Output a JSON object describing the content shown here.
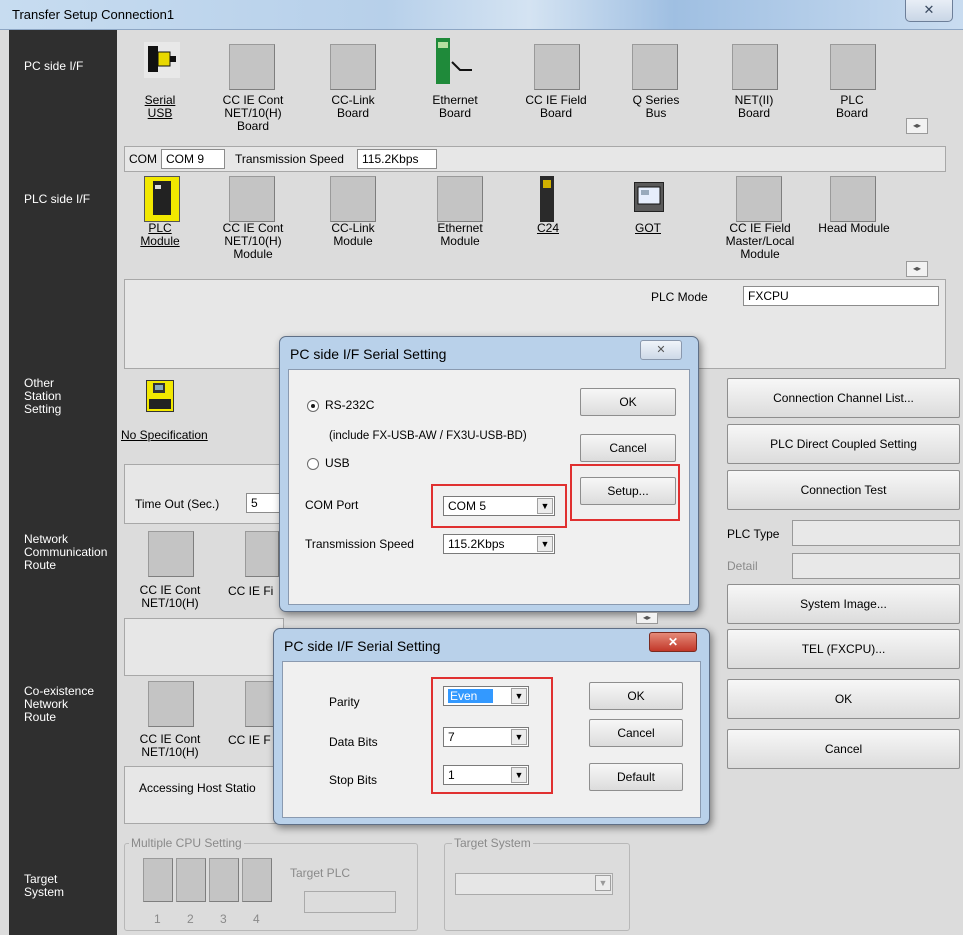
{
  "window": {
    "title": "Transfer Setup Connection1",
    "close_icon": "close-icon"
  },
  "side_labels": {
    "pc_side": "PC side I/F",
    "plc_side": "PLC side I/F",
    "other_station": [
      "Other",
      "Station",
      "Setting"
    ],
    "network_route": [
      "Network",
      "Communication",
      "Route"
    ],
    "coexistence": [
      "Co-existence",
      "Network",
      "Route"
    ],
    "target_system": [
      "Target",
      "System"
    ]
  },
  "pc_side_items": [
    {
      "lines": [
        "Serial",
        "USB"
      ],
      "underline": true
    },
    {
      "lines": [
        "CC IE Cont",
        "NET/10(H)",
        "Board"
      ]
    },
    {
      "lines": [
        "CC-Link",
        "Board"
      ]
    },
    {
      "lines": [
        "Ethernet",
        "Board"
      ]
    },
    {
      "lines": [
        "CC IE Field",
        "Board"
      ]
    },
    {
      "lines": [
        "Q Series",
        "Bus"
      ]
    },
    {
      "lines": [
        "NET(II)",
        "Board"
      ]
    },
    {
      "lines": [
        "PLC",
        "Board"
      ]
    }
  ],
  "pc_info": {
    "com_label": "COM",
    "com_value": "COM 9",
    "speed_label": "Transmission Speed",
    "speed_value": "115.2Kbps"
  },
  "plc_side_items": [
    {
      "lines": [
        "PLC",
        "Module"
      ],
      "underline": true
    },
    {
      "lines": [
        "CC IE Cont",
        "NET/10(H)",
        "Module"
      ]
    },
    {
      "lines": [
        "CC-Link",
        "Module"
      ]
    },
    {
      "lines": [
        "Ethernet",
        "Module"
      ]
    },
    {
      "lines": [
        "C24"
      ],
      "underline": true
    },
    {
      "lines": [
        "GOT"
      ],
      "underline": true
    },
    {
      "lines": [
        "CC IE Field",
        "Master/Local",
        "Module"
      ]
    },
    {
      "lines": [
        "Head Module"
      ]
    }
  ],
  "plc_mode": {
    "label": "PLC Mode",
    "value": "FXCPU"
  },
  "other_station": {
    "label": "No Specification",
    "timeout_label": "Time Out (Sec.)",
    "timeout_value": "5"
  },
  "network_items": [
    "CC IE Cont",
    "NET/10(H)",
    "CC IE Fi"
  ],
  "coexist_items": [
    "CC IE Cont",
    "NET/10(H)",
    "CC IE F"
  ],
  "accessing_host": "Accessing Host Statio",
  "right_buttons": {
    "channel_list": "Connection Channel List...",
    "direct_coupled": "PLC Direct Coupled Setting",
    "connection_test": "Connection Test",
    "plc_type_label": "PLC Type",
    "detail_label": "Detail",
    "system_image": "System Image...",
    "tel": "TEL (FXCPU)...",
    "ok": "OK",
    "cancel": "Cancel"
  },
  "target": {
    "multi_cpu_label": "Multiple CPU Setting",
    "target_plc_label": "Target PLC",
    "cpu_numbers": [
      "1",
      "2",
      "3",
      "4"
    ],
    "target_system_label": "Target System"
  },
  "dialog1": {
    "title": "PC side I/F Serial Setting",
    "rs232c": "RS-232C",
    "include_note": "(include FX-USB-AW / FX3U-USB-BD)",
    "usb": "USB",
    "com_port_label": "COM Port",
    "com_port_value": "COM 5",
    "speed_label": "Transmission Speed",
    "speed_value": "115.2Kbps",
    "ok": "OK",
    "cancel": "Cancel",
    "setup": "Setup..."
  },
  "dialog2": {
    "title": "PC side I/F Serial Setting",
    "parity_label": "Parity",
    "parity_value": "Even",
    "data_bits_label": "Data Bits",
    "data_bits_value": "7",
    "stop_bits_label": "Stop Bits",
    "stop_bits_value": "1",
    "ok": "OK",
    "cancel": "Cancel",
    "default": "Default"
  },
  "colors": {
    "highlight_red": "#e03030",
    "selection_blue": "#3399ff",
    "sidebar_dark": "#2f2f2f"
  }
}
